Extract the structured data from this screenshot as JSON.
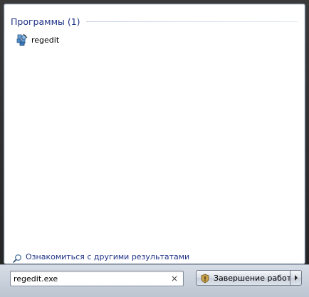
{
  "results": {
    "group_title": "Программы (1)",
    "items": [
      {
        "label": "regedit",
        "icon": "regedit-icon"
      }
    ]
  },
  "more_results": {
    "label": "Ознакомиться с другими результатами",
    "icon": "search-icon"
  },
  "search": {
    "value": "regedit.exe",
    "clear_glyph": "×"
  },
  "shutdown": {
    "label": "Завершение работы",
    "icon": "shield-icon",
    "options_icon": "arrow-right-icon"
  },
  "colors": {
    "link_blue": "#1e3287",
    "bar_bg": "#c8d0db"
  }
}
